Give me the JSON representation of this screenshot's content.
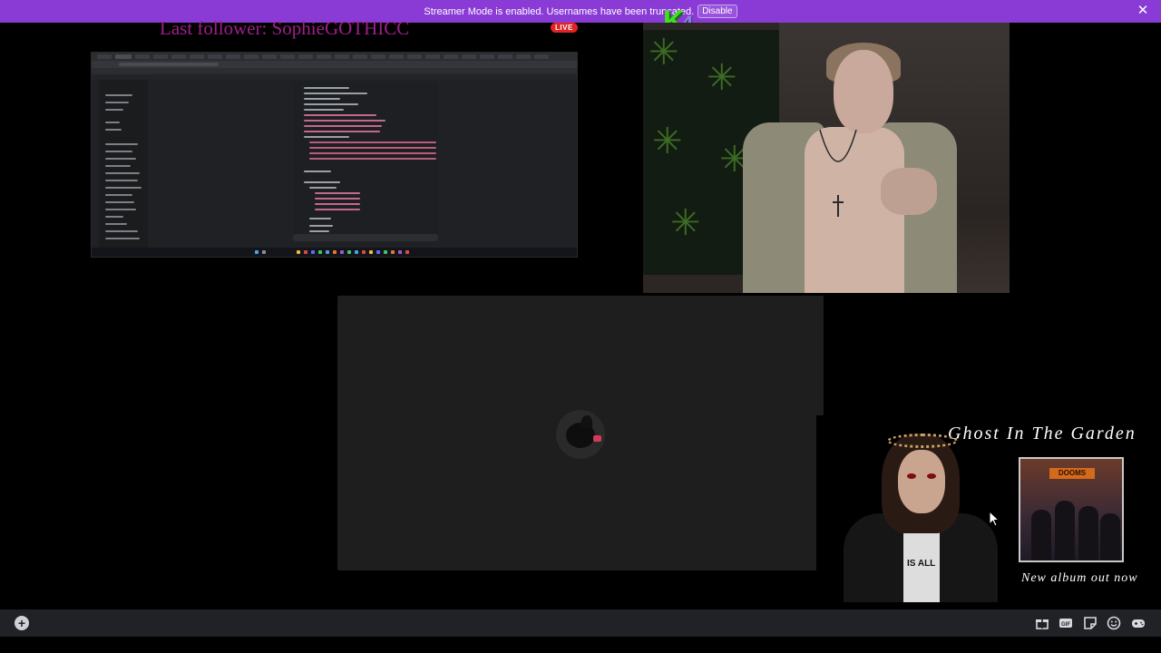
{
  "banner": {
    "message": "Streamer Mode is enabled. Usernames have been truncated.",
    "disable_label": "Disable"
  },
  "overlay": {
    "follower_text": "Last follower: SophieGOTHICC",
    "live_label": "LIVE",
    "logo_k": "K",
    "logo_4": "4"
  },
  "album_ad": {
    "title": "Ghost In The Garden",
    "tagline": "New album out now",
    "cover_logo": "DOOMS",
    "shirt_text": "IS ALL"
  },
  "bottom_bar": {
    "icons": [
      "add-icon",
      "gift-icon",
      "gif-icon",
      "sticker-icon",
      "emoji-icon",
      "activity-icon"
    ]
  },
  "colors": {
    "banner_bg": "#8a3bd6",
    "follower_text": "#9e1f8a",
    "live_red": "#e02424",
    "stage_bg": "#1e1e1e",
    "bar_bg": "#202225"
  }
}
